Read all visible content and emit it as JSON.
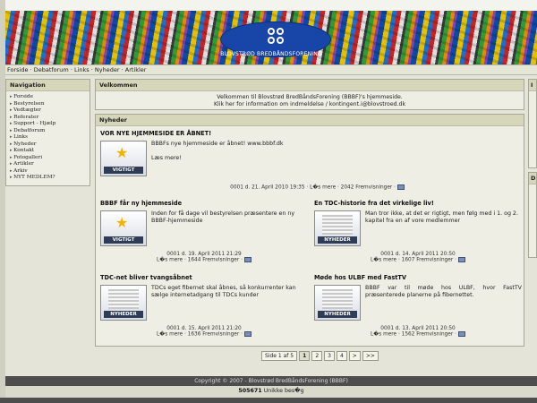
{
  "site": {
    "logo_text": "BLOVSTRØD BREDBÅNDSFORENING",
    "brand_color": "#1846a8"
  },
  "topnav": {
    "items": [
      "Forside",
      "Debatforum",
      "Links",
      "Nyheder",
      "Artikler"
    ],
    "separator": " · "
  },
  "sidebar": {
    "title": "Navigation",
    "items": [
      "Forside",
      "Bestyrelsen",
      "Vedtægter",
      "Referater",
      "Support - Hjælp",
      "Debatforum",
      "Links",
      "Nyheder",
      "Kontakt",
      "Fotogalleri",
      "Artikler",
      "Arkiv",
      "NYT MEDLEM?"
    ]
  },
  "welcome": {
    "title": "Velkommen",
    "line1": "Velkommen til Blovstrød BredBåndsForening (BBBF)'s hjemmeside.",
    "line2": "Klik her for information om indmeldelse / kontingent.i@blovstroed.dk"
  },
  "news": {
    "title": "Nyheder",
    "featured": {
      "title": "VOR NYE HJEMMESIDE ER ÅBNET!",
      "text1": "BBBFs nye hjemmeside er åbnet! www.bbbf.dk",
      "text2": "Læs mere!",
      "tag": "VIGTIGT",
      "meta": "0001 d. 21. April 2010 19:35 · L�s mere · 2042 Fremvisninger ·"
    },
    "items": [
      {
        "title": "BBBF får ny hjemmeside",
        "text": "Inden for få dage vil bestyrelsen præsentere en ny BBBF-hjemmeside",
        "tag": "VIGTIGT",
        "meta1": "0001 d. 19. April 2011 21:29",
        "meta2": "L�s mere · 1644 Fremvisninger ·"
      },
      {
        "title": "En TDC-historie fra det virkelige liv!",
        "text": "Man tror ikke, at det er rigtigt, men følg med i 1. og 2. kapitel fra en af vore medlemmer",
        "tag": "NYHEDER",
        "meta1": "0001 d. 14. April 2011 20:50",
        "meta2": "L�s mere · 1607 Fremvisninger ·"
      },
      {
        "title": "TDC-net bliver tvangsåbnet",
        "text": "TDCs eget fibernet skal åbnes, så konkurrenter kan sælge internetadgang til TDCs kunder",
        "tag": "NYHEDER",
        "meta1": "0001 d. 15. April 2011 21:20",
        "meta2": "L�s mere · 1636 Fremvisninger ·"
      },
      {
        "title": "Møde hos ULBF med FastTV",
        "text": "BBBF var til møde hos ULBF, hvor FastTV præsenterede planerne på fibernettet.",
        "tag": "NYHEDER",
        "meta1": "0001 d. 13. April 2011 20:50",
        "meta2": "L�s mere · 1562 Fremvisninger ·"
      }
    ]
  },
  "pager": {
    "label": "Side 1 af 5",
    "pages": [
      "1",
      "2",
      "3",
      "4",
      ">",
      ">>"
    ]
  },
  "footer": {
    "copyright": "Copyright © 2007 - Blovstrød BredBåndsForening (BBBF)",
    "count": "505671",
    "count_label": "Unikke bes�g"
  },
  "right": {
    "box1_letter": "I",
    "box2_letter": "D"
  }
}
